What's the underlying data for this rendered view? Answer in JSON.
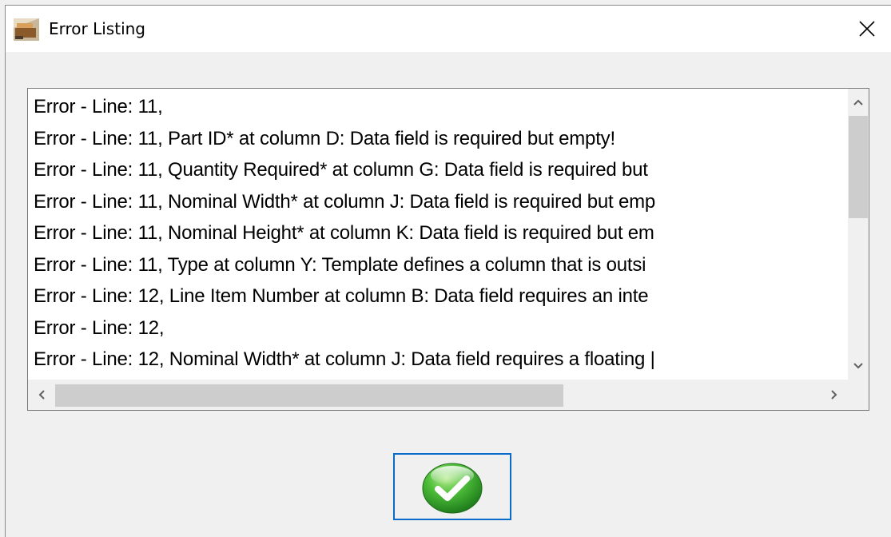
{
  "window": {
    "title": "Error Listing",
    "icons": {
      "app": "app-icon",
      "close": "close-icon"
    }
  },
  "errors": {
    "lines": [
      "Error - Line: 11,",
      "Error - Line: 11, Part ID* at column D: Data field is required but empty!",
      "Error - Line: 11, Quantity Required* at column G: Data field is required but",
      "Error - Line: 11, Nominal Width* at column J: Data field is required but emp",
      "Error - Line: 11, Nominal Height* at column K: Data field is required but em",
      "Error - Line: 11, Type at column Y: Template defines a column that is outsi",
      "Error - Line: 12, Line Item Number at column B: Data field requires an inte",
      "Error - Line: 12,",
      "Error - Line: 12, Nominal Width* at column J: Data field requires a floating |"
    ]
  },
  "scrollbars": {
    "vertical": {
      "up_icon": "chevron-up-icon",
      "down_icon": "chevron-down-icon"
    },
    "horizontal": {
      "left_icon": "chevron-left-icon",
      "right_icon": "chevron-right-icon"
    }
  },
  "ok_button": {
    "icon": "green-checkmark-icon"
  },
  "colors": {
    "focus_border": "#0a6bc9",
    "check_green": "#3cae2f"
  }
}
